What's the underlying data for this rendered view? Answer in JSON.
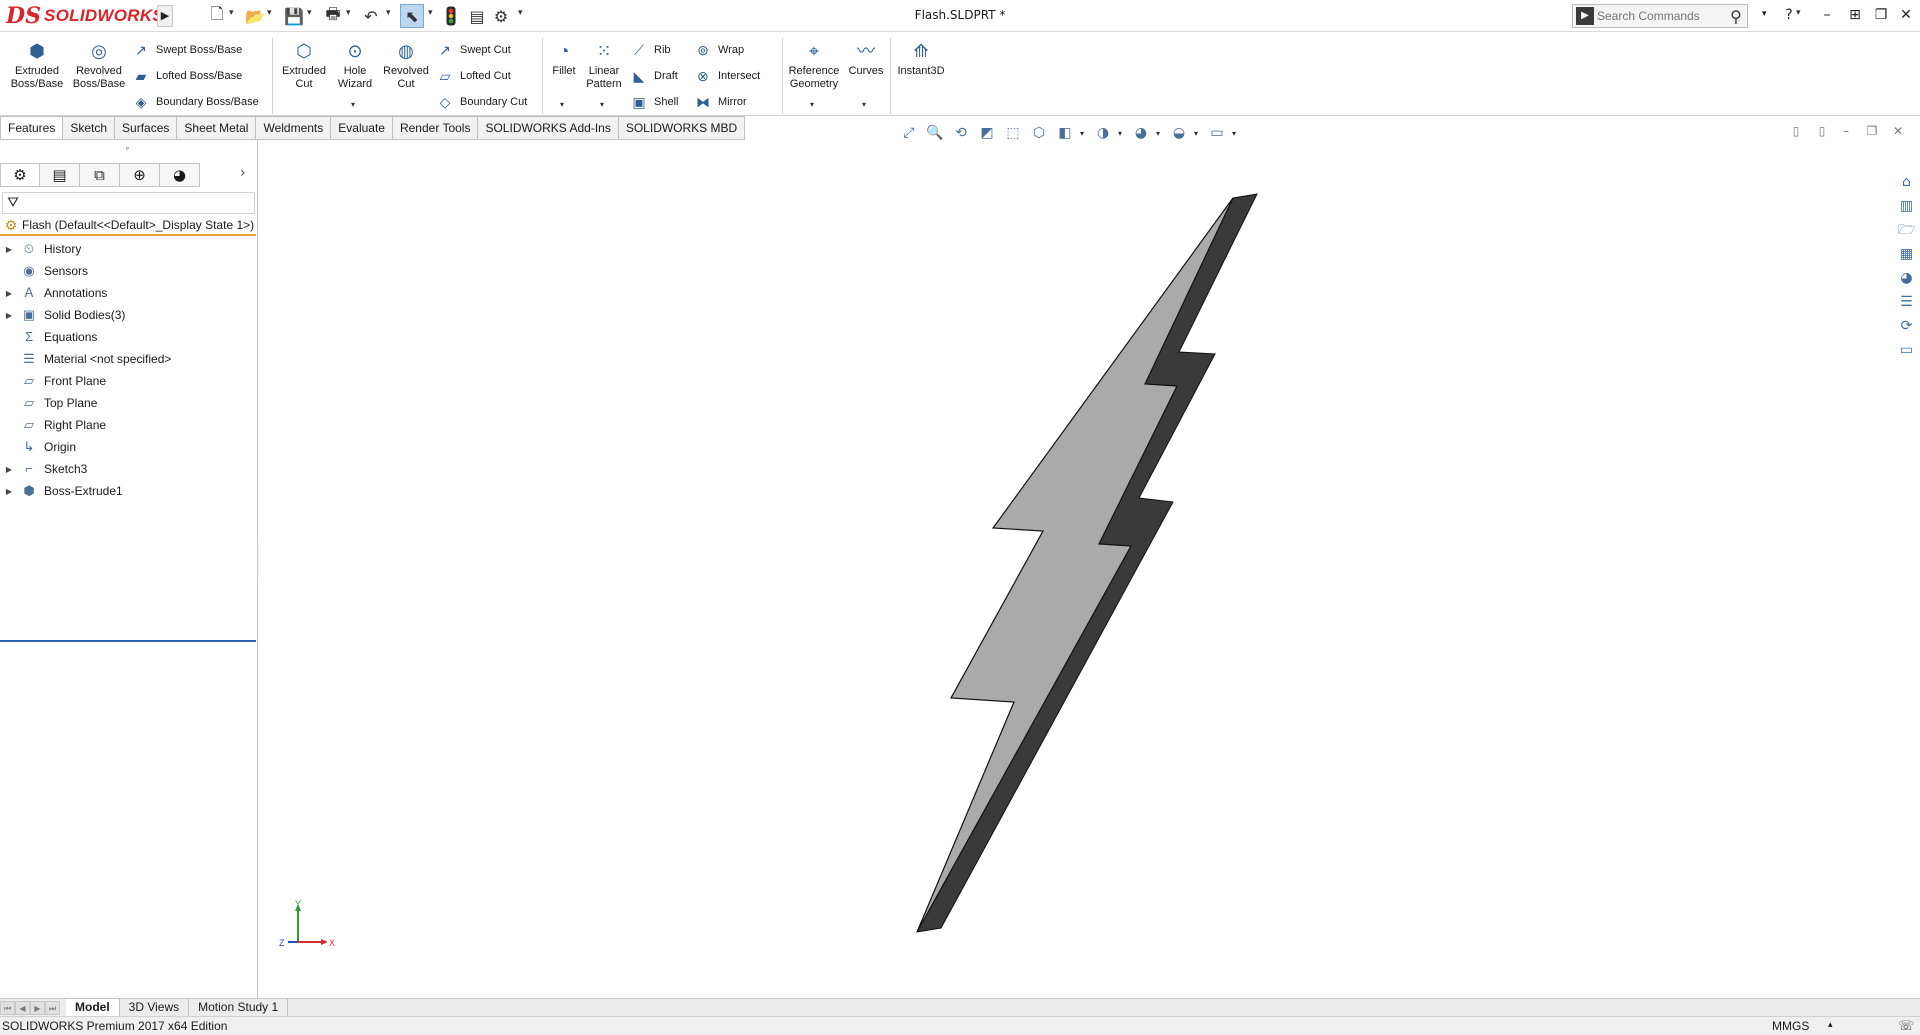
{
  "app": {
    "logo_ds": "DS",
    "logo_text": "SOLIDWORKS",
    "document_title": "Flash.SLDPRT *"
  },
  "search": {
    "placeholder": "Search Commands"
  },
  "ribbon": {
    "extruded_boss": "Extruded Boss/Base",
    "revolved_boss": "Revolved Boss/Base",
    "swept_boss": "Swept Boss/Base",
    "lofted_boss": "Lofted Boss/Base",
    "boundary_boss": "Boundary Boss/Base",
    "extruded_cut": "Extruded Cut",
    "hole_wizard": "Hole Wizard",
    "revolved_cut": "Revolved Cut",
    "swept_cut": "Swept Cut",
    "lofted_cut": "Lofted Cut",
    "boundary_cut": "Boundary Cut",
    "fillet": "Fillet",
    "linear_pattern": "Linear Pattern",
    "rib": "Rib",
    "draft": "Draft",
    "shell": "Shell",
    "wrap": "Wrap",
    "intersect": "Intersect",
    "mirror": "Mirror",
    "reference_geometry": "Reference Geometry",
    "curves": "Curves",
    "instant3d": "Instant3D"
  },
  "tabs": [
    "Features",
    "Sketch",
    "Surfaces",
    "Sheet Metal",
    "Weldments",
    "Evaluate",
    "Render Tools",
    "SOLIDWORKS Add-Ins",
    "SOLIDWORKS MBD"
  ],
  "tree": {
    "root": "Flash  (Default<<Default>_Display State 1>)",
    "items": [
      "History",
      "Sensors",
      "Annotations",
      "Solid Bodies(3)",
      "Equations",
      "Material <not specified>",
      "Front Plane",
      "Top Plane",
      "Right Plane",
      "Origin",
      "Sketch3",
      "Boss-Extrude1"
    ]
  },
  "triad": {
    "x": "X",
    "y": "Y",
    "z": "Z"
  },
  "bottom_tabs": [
    "Model",
    "3D Views",
    "Motion Study 1"
  ],
  "status": {
    "edition": "SOLIDWORKS Premium 2017 x64 Edition",
    "units": "MMGS"
  },
  "colors": {
    "brand": "#d8242c",
    "bolt_face": "#aaaaaa",
    "bolt_side": "#3a3a3a",
    "root_underline": "#e8a43b",
    "tree_end": "#2b5fb7"
  }
}
